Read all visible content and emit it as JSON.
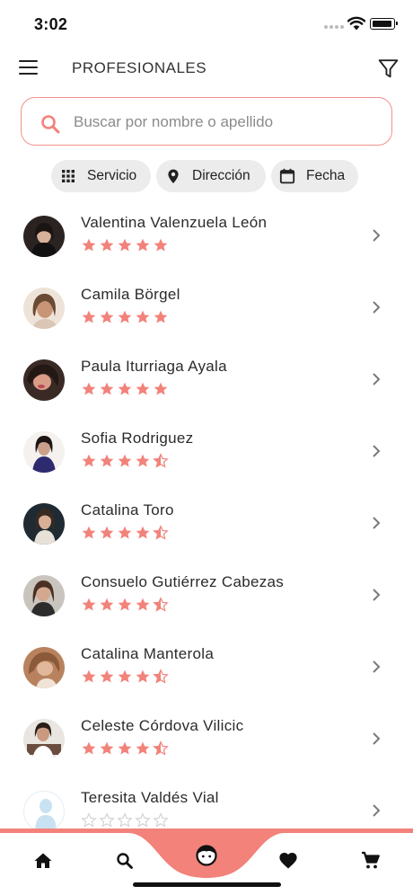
{
  "status_bar": {
    "time": "3:02"
  },
  "header": {
    "title": "PROFESIONALES",
    "menu_icon": "hamburger-menu-icon",
    "filter_icon": "funnel-filter-icon"
  },
  "search": {
    "placeholder": "Buscar por nombre o apellido",
    "value": "",
    "icon": "search-icon"
  },
  "filters": [
    {
      "label": "Servicio",
      "icon": "grid-icon"
    },
    {
      "label": "Dirección",
      "icon": "location-pin-icon"
    },
    {
      "label": "Fecha",
      "icon": "calendar-icon"
    }
  ],
  "colors": {
    "accent": "#f2827a",
    "star": "#f2827a",
    "star_empty": "#cfcfcf",
    "chip_bg": "#ececec"
  },
  "professionals": [
    {
      "name": "Valentina Valenzuela León",
      "rating": 5
    },
    {
      "name": "Camila Börgel",
      "rating": 5
    },
    {
      "name": "Paula Iturriaga Ayala",
      "rating": 5
    },
    {
      "name": "Sofia Rodriguez",
      "rating": 4.5
    },
    {
      "name": "Catalina Toro",
      "rating": 4.5
    },
    {
      "name": "Consuelo Gutiérrez Cabezas",
      "rating": 4.5
    },
    {
      "name": "Catalina Manterola",
      "rating": 4.5
    },
    {
      "name": "Celeste Córdova Vilicic",
      "rating": 4.5
    },
    {
      "name": "Teresita Valdés Vial",
      "rating": 0
    }
  ],
  "bottom_nav": [
    {
      "id": "home",
      "icon": "home-icon"
    },
    {
      "id": "search",
      "icon": "search-icon"
    },
    {
      "id": "professionals",
      "icon": "face-icon"
    },
    {
      "id": "favorites",
      "icon": "heart-icon"
    },
    {
      "id": "cart",
      "icon": "cart-icon"
    }
  ]
}
